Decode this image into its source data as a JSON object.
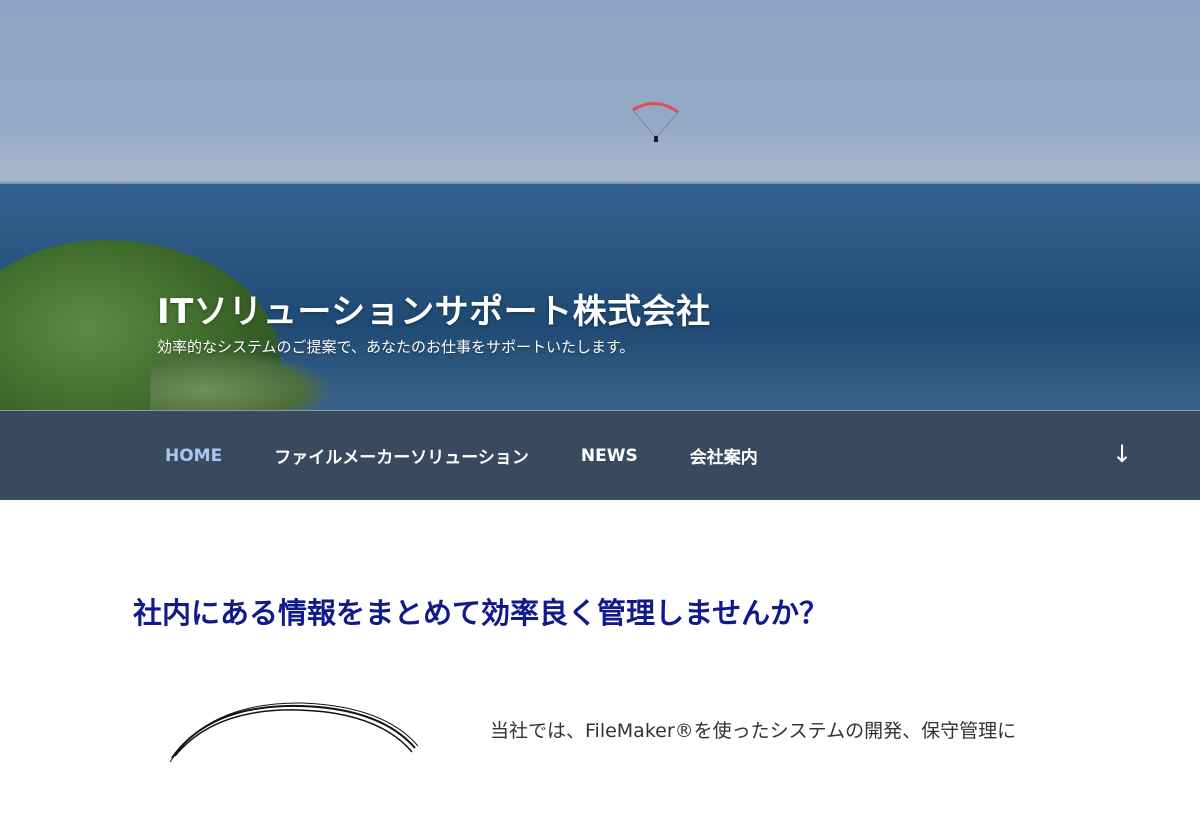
{
  "header": {
    "site_title": "ITソリューションサポート株式会社",
    "tagline": "効率的なシステムのご提案で、あなたのお仕事をサポートいたします。"
  },
  "nav": {
    "items": [
      {
        "label": "HOME",
        "active": true
      },
      {
        "label": "ファイルメーカーソリューション",
        "active": false
      },
      {
        "label": "NEWS",
        "active": false
      },
      {
        "label": "会社案内",
        "active": false
      }
    ],
    "scroll_icon": "arrow-down-icon",
    "scroll_glyph": "↓"
  },
  "main": {
    "heading": "社内にある情報をまとめて効率良く管理しませんか？",
    "intro_text": "当社では、FileMaker®を使ったシステムの開発、保守管理に"
  },
  "colors": {
    "nav_background": "#3a4a5e",
    "nav_active": "#a8c8f0",
    "heading": "#111a8c",
    "body_text": "#333333"
  }
}
